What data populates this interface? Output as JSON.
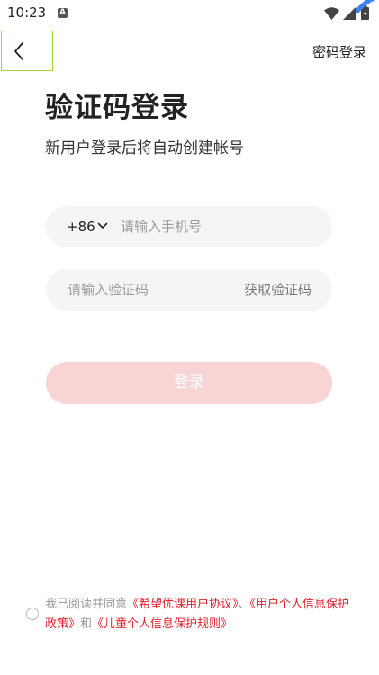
{
  "status_bar": {
    "time": "10:23",
    "notification_icon_letter": "A"
  },
  "nav": {
    "back_icon": "chevron-left-icon",
    "password_login_label": "密码登录"
  },
  "header": {
    "title": "验证码登录",
    "subtitle": "新用户登录后将自动创建帐号"
  },
  "phone": {
    "country_code": "+86",
    "placeholder": "请输入手机号",
    "value": ""
  },
  "code": {
    "placeholder": "请输入验证码",
    "value": "",
    "get_code_label": "获取验证码"
  },
  "login": {
    "label": "登录"
  },
  "agreement": {
    "prefix": "我已阅读并同意",
    "link1": "《希望优课用户协议》",
    "separator": "、",
    "link2": "《用户个人信息保护政策》",
    "conjunction": "和",
    "link3": "《儿童个人信息保护规则》"
  },
  "colors": {
    "accent": "#e1232e",
    "login_disabled_bg": "#f8d4d5",
    "input_bg": "#f5f5f5"
  }
}
